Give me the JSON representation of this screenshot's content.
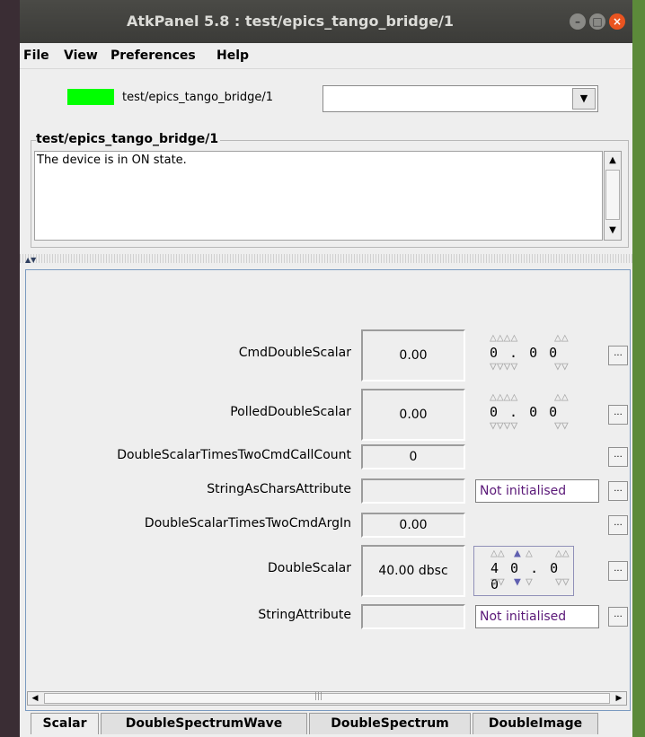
{
  "window": {
    "title": "AtkPanel 5.8 : test/epics_tango_bridge/1"
  },
  "window_buttons": {
    "minimize": "–",
    "maximize": "□",
    "close": "×"
  },
  "menu": {
    "items": [
      "File",
      "View",
      "Preferences",
      "Help"
    ]
  },
  "device": {
    "name": "test/epics_tango_bridge/1",
    "state_color": "#00ff00",
    "selector_value": ""
  },
  "status_group": {
    "title": "test/epics_tango_bridge/1",
    "text": "The device is in ON state."
  },
  "attributes": [
    {
      "label": "CmdDoubleScalar",
      "value": "0.00",
      "setter": "wheel",
      "wheel_digits": "0 . 0 0"
    },
    {
      "label": "PolledDoubleScalar",
      "value": "0.00",
      "setter": "wheel",
      "wheel_digits": "0 . 0 0"
    },
    {
      "label": "DoubleScalarTimesTwoCmdCallCount",
      "value": "0",
      "setter": "none"
    },
    {
      "label": "StringAsCharsAttribute",
      "value": "",
      "setter": "text",
      "text_value": "Not initialised"
    },
    {
      "label": "DoubleScalarTimesTwoCmdArgIn",
      "value": "0.00",
      "setter": "none"
    },
    {
      "label": "DoubleScalar",
      "value": "40.00 dbsc",
      "setter": "wheel",
      "wheel_digits": "4 0 . 0 0"
    },
    {
      "label": "StringAttribute",
      "value": "",
      "setter": "text",
      "text_value": "Not initialised"
    }
  ],
  "more_button_label": "...",
  "tabs": [
    "Scalar",
    "DoubleSpectrumWave",
    "DoubleSpectrum",
    "DoubleImage"
  ],
  "active_tab": "Scalar",
  "hscroll_grip": "|||"
}
